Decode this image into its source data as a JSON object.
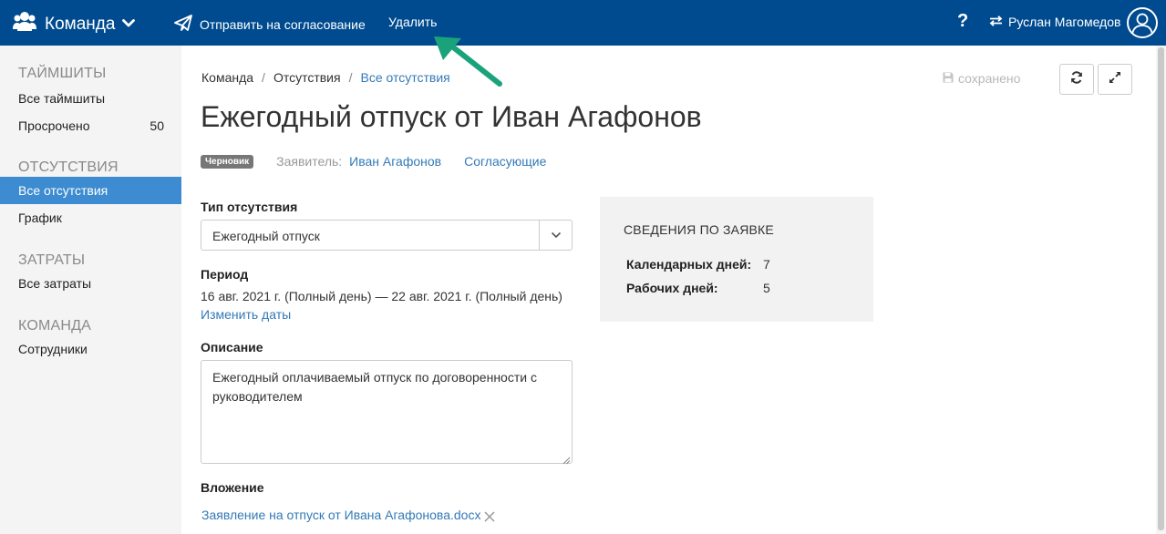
{
  "topbar": {
    "brand_label": "Команда",
    "send_label": "Отправить на согласование",
    "delete_label": "Удалить",
    "help_label": "?",
    "user_name": "Руслан Магомедов"
  },
  "sidebar": {
    "sections": [
      {
        "title": "ТАЙМШИТЫ",
        "items": [
          {
            "label": "Все таймшиты"
          },
          {
            "label": "Просрочено",
            "count": "50"
          }
        ]
      },
      {
        "title": "ОТСУТСТВИЯ",
        "items": [
          {
            "label": "Все отсутствия",
            "active": true
          },
          {
            "label": "График"
          }
        ]
      },
      {
        "title": "ЗАТРАТЫ",
        "items": [
          {
            "label": "Все затраты"
          }
        ]
      },
      {
        "title": "КОМАНДА",
        "items": [
          {
            "label": "Сотрудники"
          }
        ]
      }
    ]
  },
  "breadcrumb": {
    "items": [
      "Команда",
      "Отсутствия",
      "Все отсутствия"
    ],
    "separator": "/"
  },
  "saved_label": "сохранено",
  "page_title": "Ежегодный отпуск от Иван Агафонов",
  "meta": {
    "badge": "Черновик",
    "applicant_label": "Заявитель:",
    "applicant_name": "Иван Агафонов",
    "approvers_link": "Согласующие"
  },
  "form": {
    "type_label": "Тип отсутствия",
    "type_value": "Ежегодный отпуск",
    "period_label": "Период",
    "period_value": "16 авг. 2021 г. (Полный день) — 22 авг. 2021 г. (Полный день)",
    "change_dates_link": "Изменить даты",
    "description_label": "Описание",
    "description_value": "Ежегодный оплачиваемый отпуск по договоренности с руководителем",
    "attachment_label": "Вложение",
    "attachment_name": "Заявление на отпуск от Ивана Агафонова.docx"
  },
  "info": {
    "title": "СВЕДЕНИЯ ПО ЗАЯВКЕ",
    "rows": [
      {
        "label": "Календарных дней:",
        "value": "7"
      },
      {
        "label": "Рабочих дней:",
        "value": "5"
      }
    ]
  },
  "colors": {
    "topbar": "#004b8f",
    "sidebar_active": "#3d8bd0",
    "link": "#337ab7",
    "annotation_arrow": "#1aa37a",
    "badge": "#777777"
  },
  "icons": {
    "brand": "team-icon",
    "send": "paper-plane-icon",
    "switch": "swap-icon",
    "avatar": "user-avatar-icon",
    "saved": "floppy-disk-icon",
    "refresh": "refresh-icon",
    "expand": "expand-icon"
  }
}
